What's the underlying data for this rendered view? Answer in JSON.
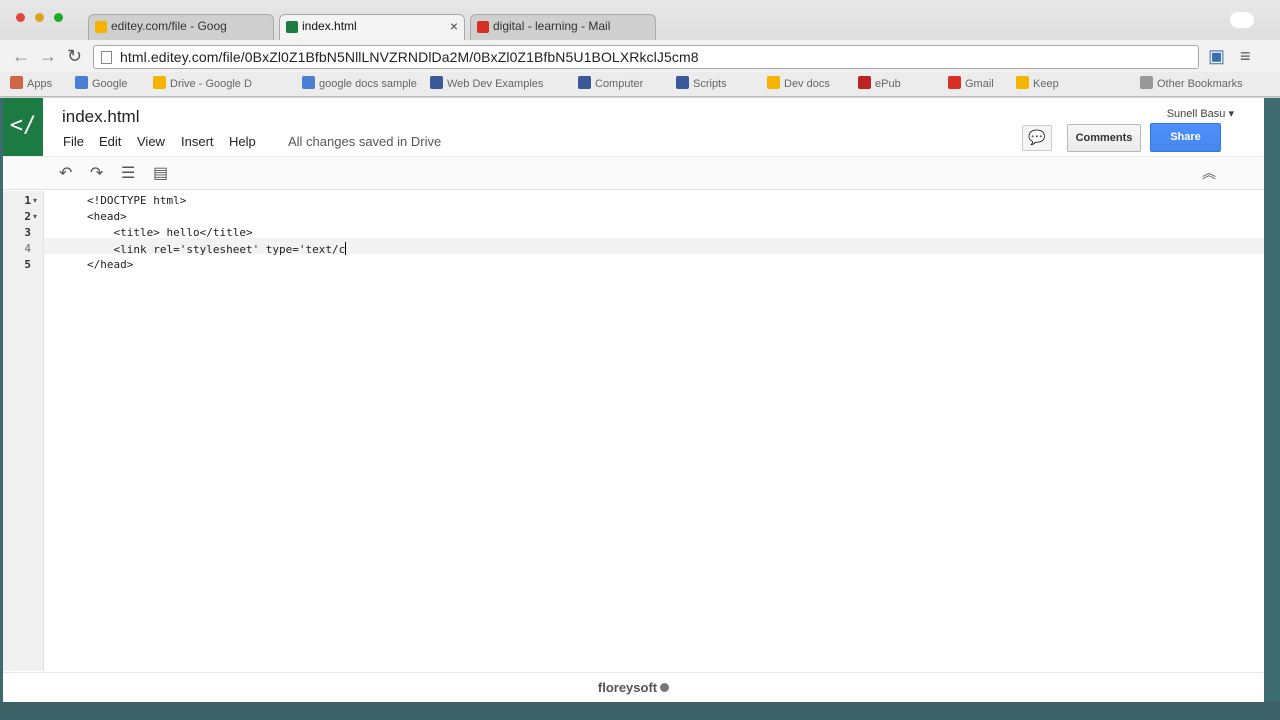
{
  "browser": {
    "tabs": [
      {
        "label": "editey.com/file - Goog",
        "active": false
      },
      {
        "label": "index.html",
        "active": true
      },
      {
        "label": "digital - learning - Mail",
        "active": false
      }
    ],
    "url": "html.editey.com/file/0BxZl0Z1BfbN5NllLNVZRNDlDa2M/0BxZl0Z1BfbN5U1BOLXRkclJ5cm8",
    "bookmarks": [
      "Apps",
      "Google",
      "Drive - Google D",
      "google docs sample",
      "Web Dev Examples",
      "Computer",
      "Scripts",
      "Dev docs",
      "ePub",
      "Gmail",
      "Keep",
      "Other Bookmarks"
    ]
  },
  "app": {
    "logo_glyph": "</",
    "doc_title": "index.html",
    "menu": [
      "File",
      "Edit",
      "View",
      "Insert",
      "Help"
    ],
    "save_status": "All changes saved in Drive",
    "user_name": "Sunell Basu ▾",
    "comments_label": "Comments",
    "share_label": "Share"
  },
  "editor": {
    "lines": [
      {
        "num": "1",
        "text": "<!DOCTYPE html>",
        "fold": "▾"
      },
      {
        "num": "2",
        "text": "<head>",
        "fold": "▾"
      },
      {
        "num": "3",
        "text": "    <title> hello</title>",
        "fold": ""
      },
      {
        "num": "4",
        "text": "    <link rel='stylesheet' type='text/c",
        "fold": ""
      },
      {
        "num": "5",
        "text": "</head>",
        "fold": ""
      }
    ],
    "active_line": 4
  },
  "footer": {
    "brand": "floreysoft"
  },
  "colors": {
    "accent_green": "#1c7a43",
    "share_blue": "#4d90fe"
  }
}
